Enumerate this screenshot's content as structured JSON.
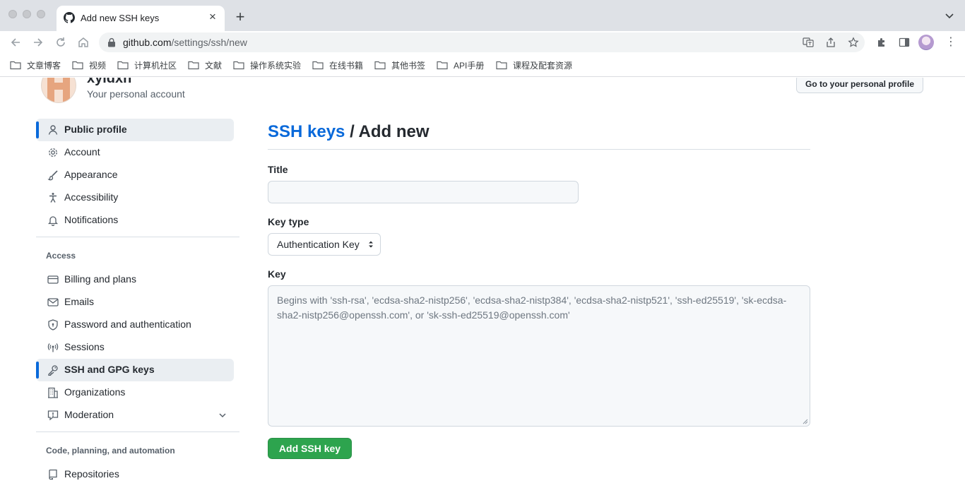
{
  "browser": {
    "tab_title": "Add new SSH keys",
    "new_tab_symbol": "+",
    "tab_close_symbol": "×",
    "url_host": "github.com",
    "url_path": "/settings/ssh/new",
    "menu_symbol": "⋮",
    "bookmarks": [
      "文章博客",
      "视频",
      "计算机社区",
      "文献",
      "操作系统实验",
      "在线书籍",
      "其他书签",
      "API手册",
      "课程及配套资源"
    ]
  },
  "header": {
    "username": "xyldxh",
    "account_subtitle": "Your personal account",
    "profile_button": "Go to your personal profile"
  },
  "sidebar": {
    "items": [
      {
        "label": "Public profile",
        "icon": "person-icon",
        "active": true
      },
      {
        "label": "Account",
        "icon": "gear-icon"
      },
      {
        "label": "Appearance",
        "icon": "paintbrush-icon"
      },
      {
        "label": "Accessibility",
        "icon": "accessibility-icon"
      },
      {
        "label": "Notifications",
        "icon": "bell-icon"
      }
    ],
    "access_heading": "Access",
    "access_items": [
      {
        "label": "Billing and plans",
        "icon": "credit-card-icon"
      },
      {
        "label": "Emails",
        "icon": "mail-icon"
      },
      {
        "label": "Password and authentication",
        "icon": "shield-lock-icon"
      },
      {
        "label": "Sessions",
        "icon": "broadcast-icon"
      },
      {
        "label": "SSH and GPG keys",
        "icon": "key-icon",
        "active": true
      },
      {
        "label": "Organizations",
        "icon": "organization-icon"
      },
      {
        "label": "Moderation",
        "icon": "report-icon",
        "expandable": true
      }
    ],
    "code_heading": "Code, planning, and automation",
    "code_items": [
      {
        "label": "Repositories",
        "icon": "repo-icon"
      }
    ]
  },
  "main": {
    "breadcrumb_link": "SSH keys",
    "breadcrumb_separator": "/",
    "breadcrumb_current": "Add new",
    "title_label": "Title",
    "title_value": "",
    "key_type_label": "Key type",
    "key_type_value": "Authentication Key",
    "key_label": "Key",
    "key_placeholder": "Begins with 'ssh-rsa', 'ecdsa-sha2-nistp256', 'ecdsa-sha2-nistp384', 'ecdsa-sha2-nistp521', 'ssh-ed25519', 'sk-ecdsa-sha2-nistp256@openssh.com', or 'sk-ssh-ed25519@openssh.com'",
    "submit_label": "Add SSH key"
  },
  "colors": {
    "link": "#0969da",
    "primary_button": "#2da44e",
    "active_bar": "#0969da"
  }
}
